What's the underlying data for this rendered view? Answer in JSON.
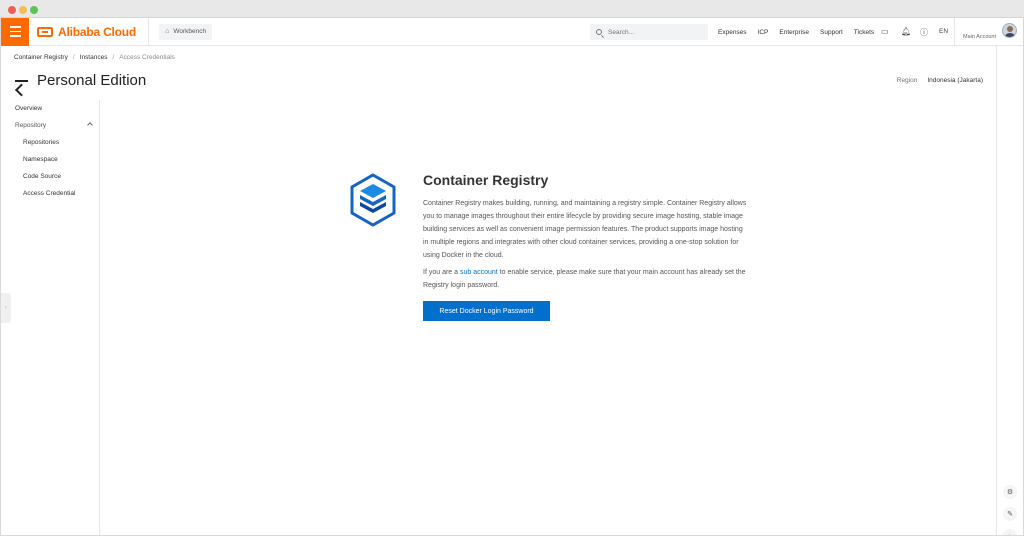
{
  "topnav": {
    "brand": "Alibaba Cloud",
    "workbench": "Workbench",
    "search_placeholder": "Search...",
    "links": [
      "Expenses",
      "ICP",
      "Enterprise",
      "Support",
      "Tickets"
    ],
    "language": "EN",
    "account": "Main Account"
  },
  "breadcrumb": [
    "Container Registry",
    "Instances",
    "Access Credentials"
  ],
  "page": {
    "title": "Personal Edition",
    "region_label": "Region",
    "region_value": "Indonesia (Jakarta)"
  },
  "sidebar": {
    "items": [
      {
        "label": "Overview"
      },
      {
        "label": "Repository"
      },
      {
        "label": "Repositories"
      },
      {
        "label": "Namespace"
      },
      {
        "label": "Code Source"
      },
      {
        "label": "Access Credential"
      }
    ]
  },
  "main": {
    "title": "Container Registry",
    "description": "Container Registry makes building, running, and maintaining a registry simple. Container Registry allows you to manage images throughout their entire lifecycle by providing secure image hosting, stable image building services as well as convenient image permission features. The product supports image hosting in multiple regions and integrates with other cloud container services, providing a one-stop solution for using Docker in the cloud.",
    "note_before": "If you are a ",
    "note_link": "sub account",
    "note_after": " to enable service, please make sure that your main account has already set the Registry login password.",
    "button": "Reset Docker Login Password"
  },
  "colors": {
    "brand": "#ff6a00",
    "primary": "#0070cc"
  },
  "icons": [
    "menu-icon",
    "home-icon",
    "search-icon",
    "terminal-icon",
    "bell-icon",
    "help-icon",
    "back-arrow-icon",
    "chevron-up-icon",
    "settings-icon",
    "edit-icon",
    "chevron-right-icon",
    "container-registry-icon"
  ]
}
